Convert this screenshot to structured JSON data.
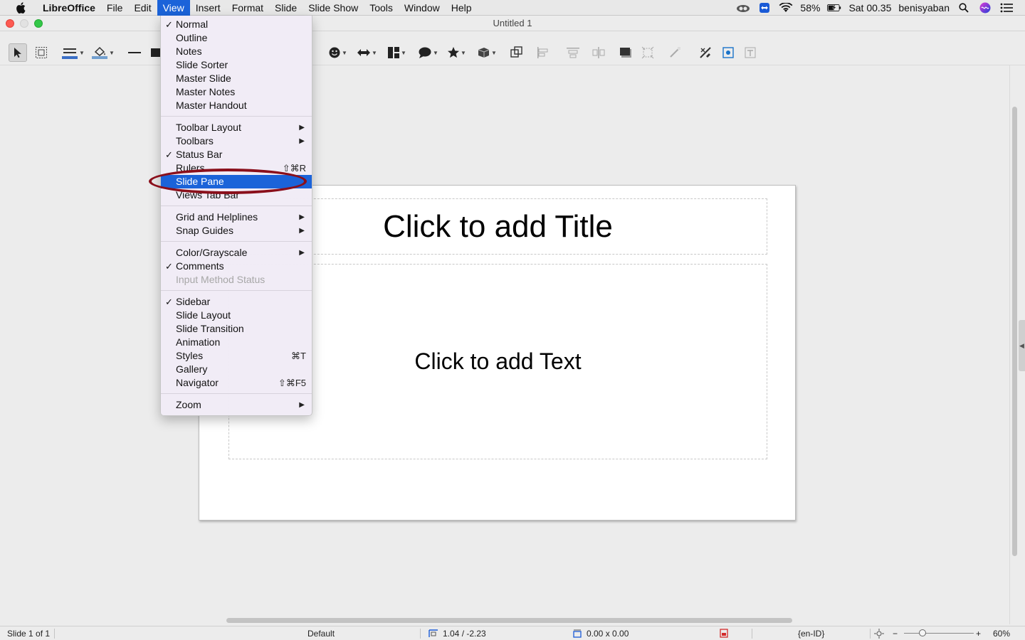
{
  "menubar": {
    "app": "LibreOffice",
    "items": [
      "File",
      "Edit",
      "View",
      "Insert",
      "Format",
      "Slide",
      "Slide Show",
      "Tools",
      "Window",
      "Help"
    ],
    "active": "View",
    "battery": "58%",
    "clock": "Sat 00.35",
    "user": "benisyaban"
  },
  "window": {
    "title": "Untitled 1"
  },
  "slide": {
    "title_placeholder": "Click to add Title",
    "text_placeholder": "Click to add Text"
  },
  "view_menu": {
    "items": [
      {
        "label": "Normal",
        "checked": true
      },
      {
        "label": "Outline"
      },
      {
        "label": "Notes"
      },
      {
        "label": "Slide Sorter"
      },
      {
        "label": "Master Slide"
      },
      {
        "label": "Master Notes"
      },
      {
        "label": "Master Handout"
      },
      {
        "separator": true
      },
      {
        "label": "Toolbar Layout",
        "submenu": true
      },
      {
        "label": "Toolbars",
        "submenu": true
      },
      {
        "label": "Status Bar",
        "checked": true
      },
      {
        "label": "Rulers",
        "shortcut": "⇧⌘R"
      },
      {
        "label": "Slide Pane",
        "highlighted": true
      },
      {
        "label": "Views Tab Bar"
      },
      {
        "separator": true
      },
      {
        "label": "Grid and Helplines",
        "submenu": true
      },
      {
        "label": "Snap Guides",
        "submenu": true
      },
      {
        "separator": true
      },
      {
        "label": "Color/Grayscale",
        "submenu": true
      },
      {
        "label": "Comments",
        "checked": true
      },
      {
        "label": "Input Method Status",
        "disabled": true
      },
      {
        "separator": true
      },
      {
        "label": "Sidebar",
        "checked": true
      },
      {
        "label": "Slide Layout"
      },
      {
        "label": "Slide Transition"
      },
      {
        "label": "Animation"
      },
      {
        "label": "Styles",
        "shortcut": "⌘T"
      },
      {
        "label": "Gallery"
      },
      {
        "label": "Navigator",
        "shortcut": "⇧⌘F5"
      },
      {
        "separator": true
      },
      {
        "label": "Zoom",
        "submenu": true
      }
    ]
  },
  "statusbar": {
    "slide_info": "Slide 1 of 1",
    "master": "Default",
    "position": "1.04 / -2.23",
    "size": "0.00 x 0.00",
    "language": "{en-ID}",
    "zoom_minus": "−",
    "zoom_plus": "+",
    "zoom": "60%"
  },
  "colors": {
    "menu_highlight": "#1b63d9",
    "annotation_ring": "#8a0f1b",
    "line_color_swatch": "#3a6fc6",
    "fill_color_swatch": "#729fcf"
  }
}
